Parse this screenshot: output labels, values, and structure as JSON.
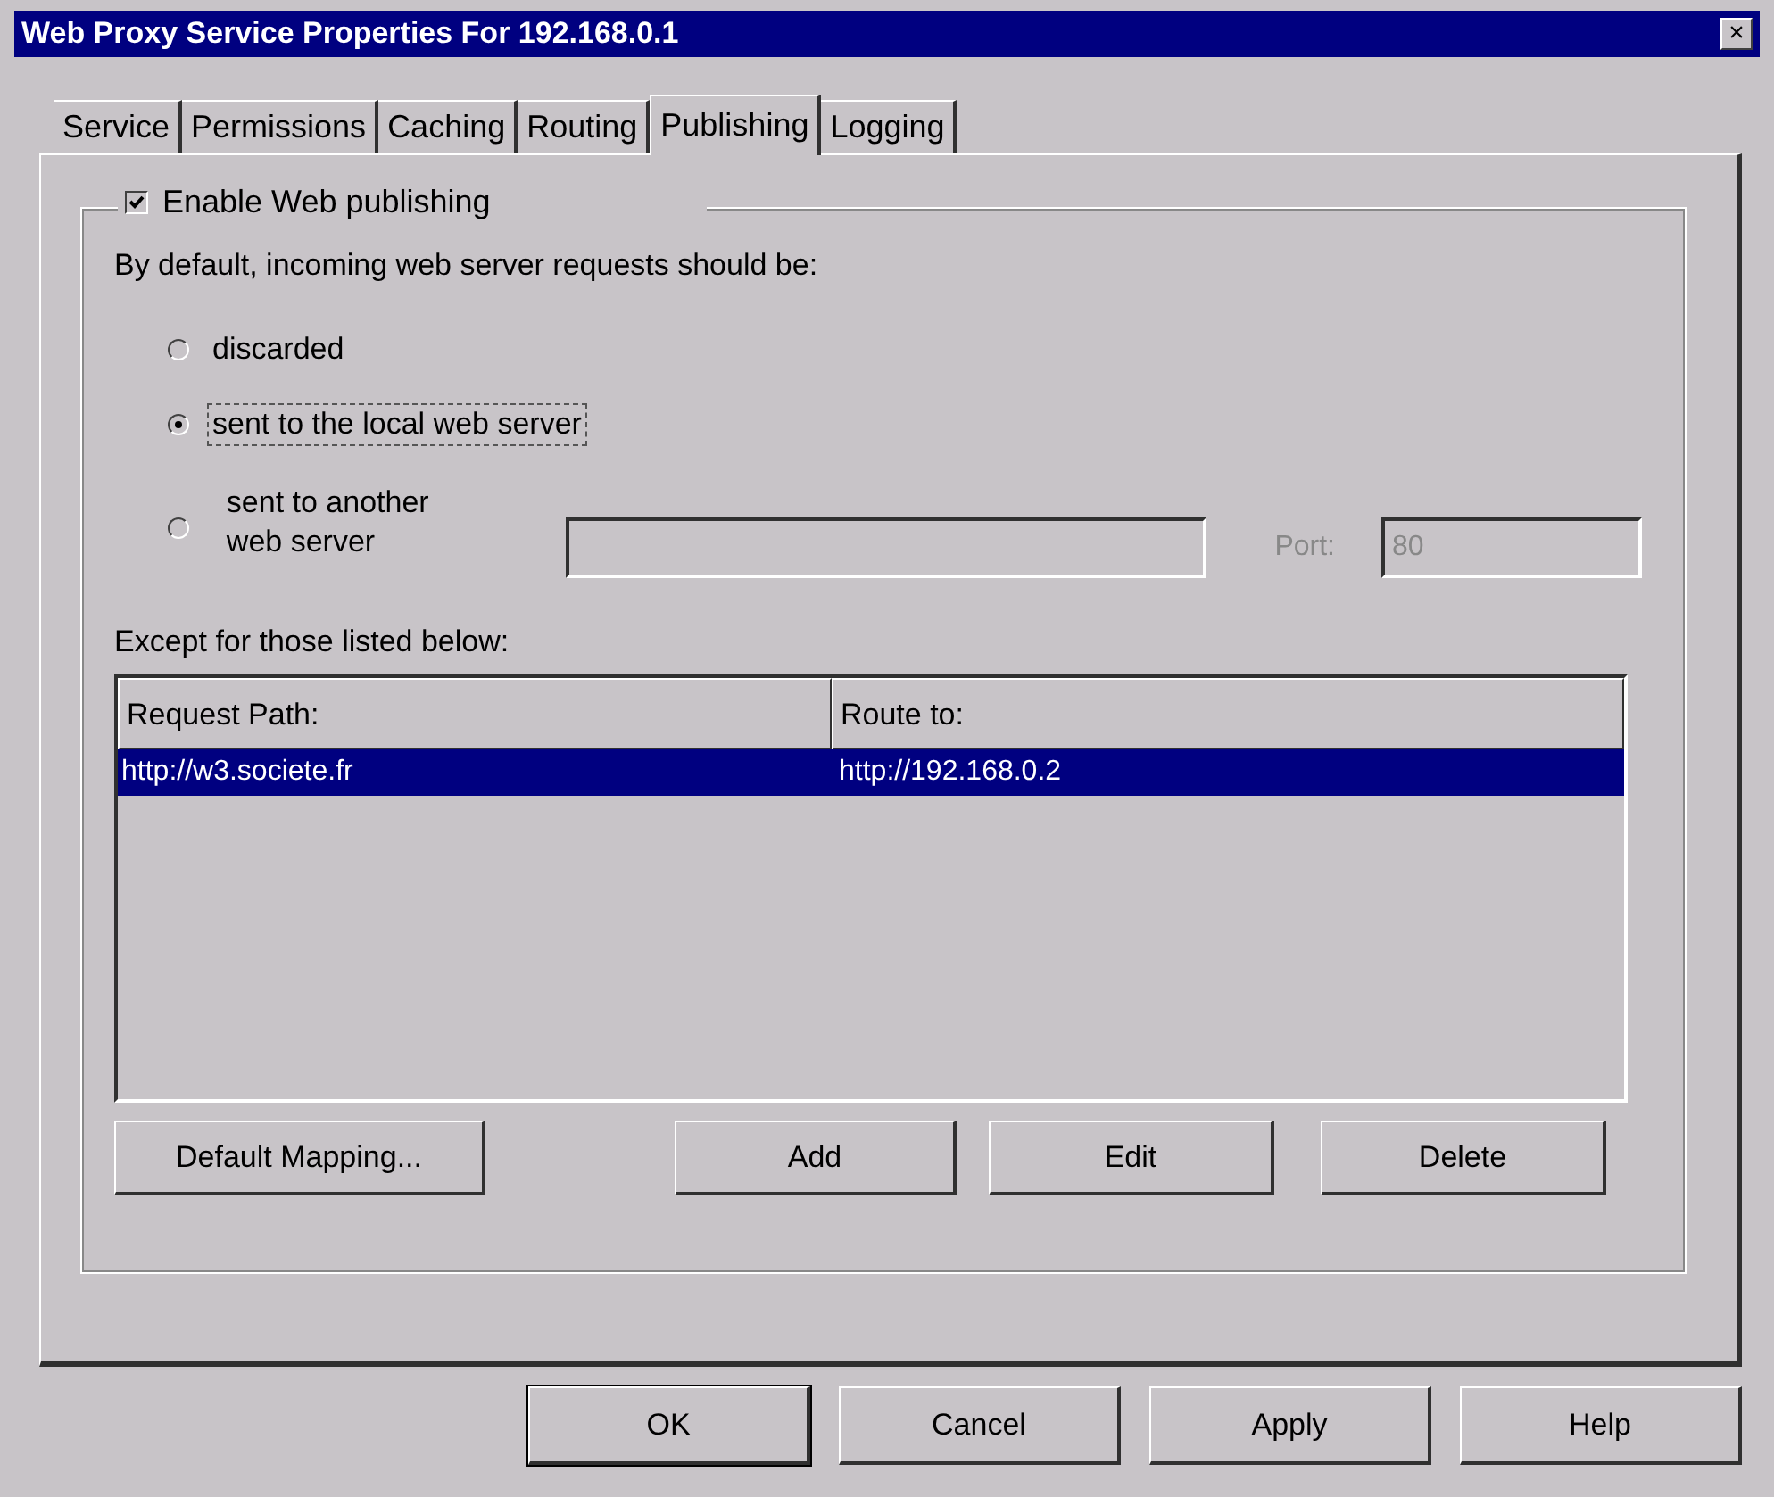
{
  "window": {
    "title": "Web Proxy Service Properties For 192.168.0.1",
    "close": "×"
  },
  "tabs": [
    {
      "label": "Service",
      "selected": false
    },
    {
      "label": "Permissions",
      "selected": false
    },
    {
      "label": "Caching",
      "selected": false
    },
    {
      "label": "Routing",
      "selected": false
    },
    {
      "label": "Publishing",
      "selected": true
    },
    {
      "label": "Logging",
      "selected": false
    }
  ],
  "enable": {
    "label": "Enable Web publishing",
    "checked": true
  },
  "prompt": "By default, incoming web server requests should be:",
  "options": [
    {
      "label": "discarded",
      "selected": false
    },
    {
      "label": "sent to the local web server",
      "selected": true
    },
    {
      "label": "sent to another web server",
      "selected": false
    }
  ],
  "server_field": {
    "disabled": true
  },
  "port": {
    "label": "Port:",
    "value": "80",
    "disabled": true
  },
  "except_label": "Except for those listed below:",
  "table": {
    "columns": [
      "Request Path:",
      "Route to:"
    ],
    "rows": [
      {
        "cells": [
          "http://w3.societe.fr",
          "http://192.168.0.2"
        ],
        "selected": true
      }
    ]
  },
  "table_buttons": [
    "Default Mapping...",
    "Add",
    "Edit",
    "Delete"
  ],
  "dialog_buttons": [
    "OK",
    "Cancel",
    "Apply",
    "Help"
  ]
}
